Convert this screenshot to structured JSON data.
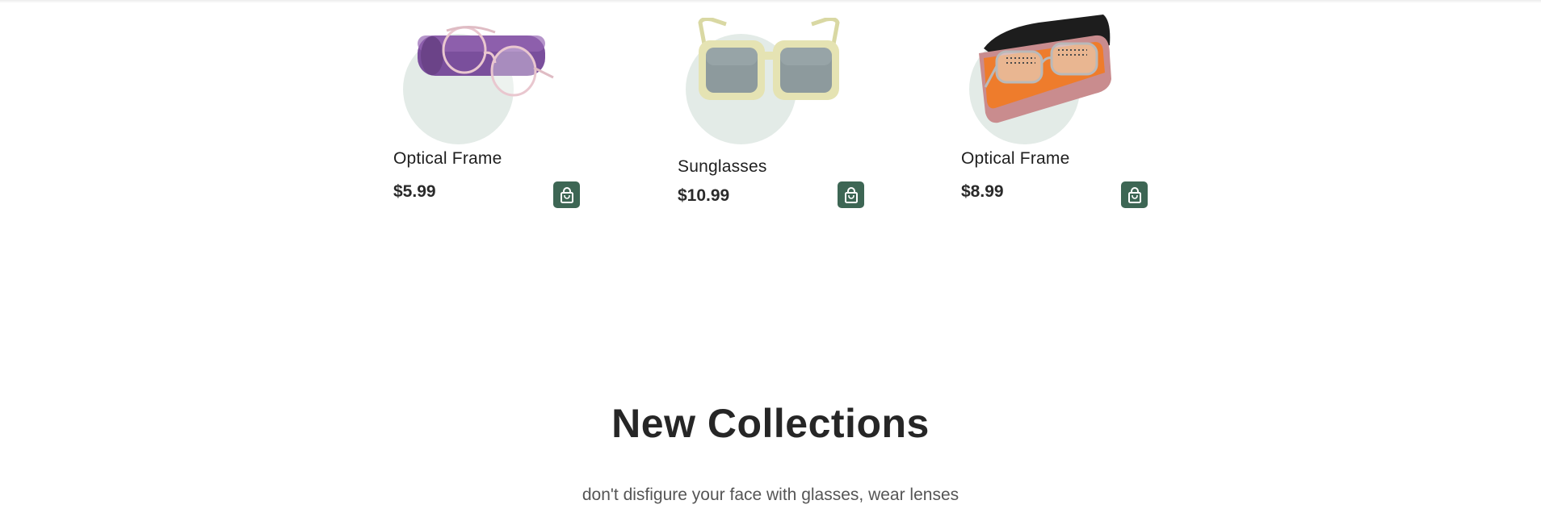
{
  "products": [
    {
      "name": "Optical Frame",
      "price": "$5.99",
      "image": "glasses-on-purple-case"
    },
    {
      "name": "Sunglasses",
      "price": "$10.99",
      "image": "square-yellow-sunglasses"
    },
    {
      "name": "Optical Frame",
      "price": "$8.99",
      "image": "glasses-in-open-case"
    }
  ],
  "collections": {
    "title": "New Collections",
    "subtitle": "don't disfigure your face with glasses, wear lenses"
  },
  "colors": {
    "accent": "#3d6654",
    "circle": "#e3ebe7",
    "text": "#1f1f1f"
  },
  "icons": {
    "cart": "shopping-bag-icon"
  }
}
